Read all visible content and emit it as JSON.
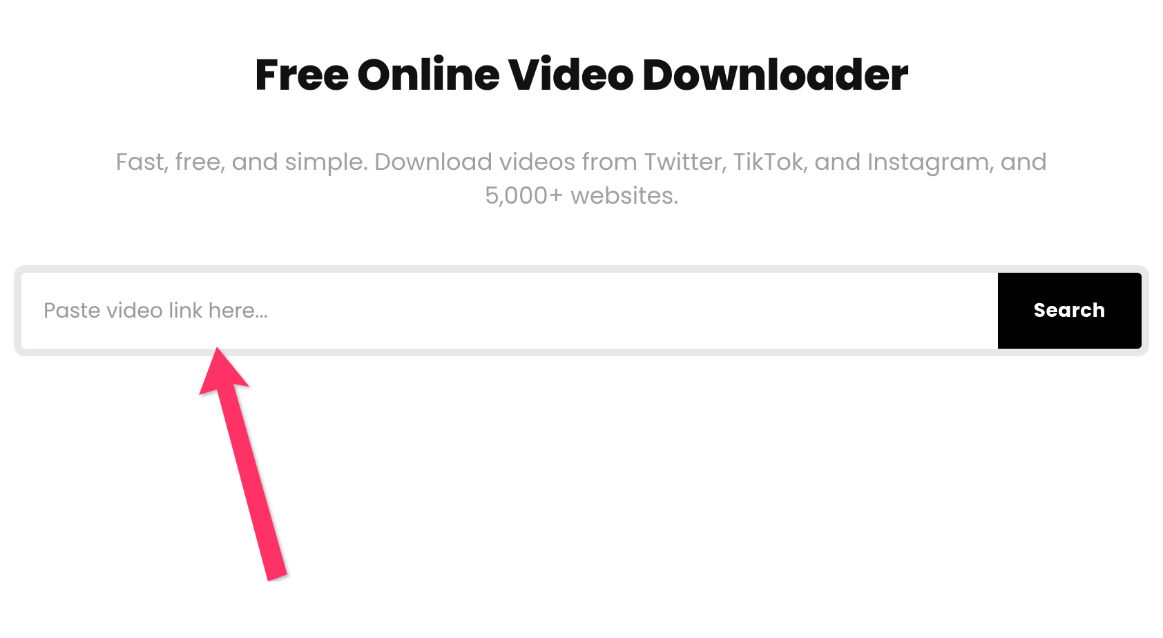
{
  "header": {
    "title": "Free Online Video Downloader",
    "subtitle": "Fast, free, and simple. Download videos from Twitter, TikTok, and Instagram, and 5,000+ websites."
  },
  "search": {
    "placeholder": "Paste video link here...",
    "value": "",
    "button_label": "Search"
  },
  "annotation": {
    "arrow_color": "#ff3366"
  }
}
